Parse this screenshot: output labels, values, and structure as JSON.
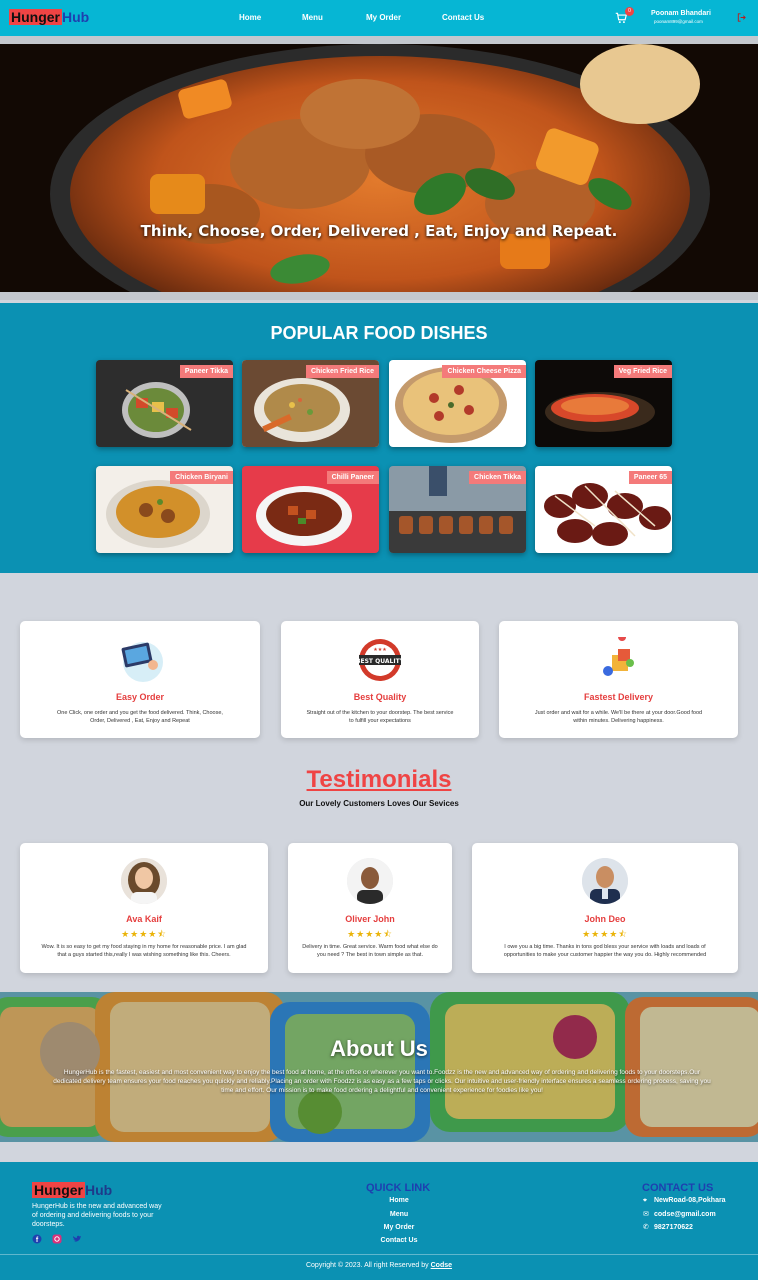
{
  "nav": {
    "logo_a": "Hunger",
    "logo_b": "Hub",
    "links": [
      "Home",
      "Menu",
      "My Order",
      "Contact Us"
    ],
    "cart_count": "0",
    "cart_icon": "cart-icon",
    "user_name": "Poonam Bhandari",
    "user_email": "poonam899@gmail.com",
    "logout_icon": "logout-icon"
  },
  "hero": {
    "tagline": "Think, Choose, Order, Delivered , Eat, Enjoy and Repeat."
  },
  "popular": {
    "title": "POPULAR FOOD DISHES",
    "dishes": [
      "Paneer Tikka",
      "Chicken Fried Rice",
      "Chicken Cheese Pizza",
      "Veg Fried Rice",
      "Chicken Biryani",
      "Chilli Paneer",
      "Chicken Tikka",
      "Paneer 65"
    ]
  },
  "features": [
    {
      "title": "Easy Order",
      "text": "One Click, one order and you get the food delivered. Think, Choose, Order, Delivered , Eat, Enjoy and Repeat",
      "icon": "tablet-order-icon"
    },
    {
      "title": "Best Quality",
      "text": "Straight out of the kitchen to your doorstep. The best service to fulfill your expectations",
      "icon": "best-quality-badge-icon"
    },
    {
      "title": "Fastest Delivery",
      "text": "Just order and wait for a while. We'll be there at your door.Good food within minutes. Delivering happiness.",
      "icon": "delivery-icon"
    }
  ],
  "testimonials": {
    "title": "Testimonials",
    "subtitle": "Our Lovely Customers Loves Our Sevices",
    "items": [
      {
        "name": "Ava Kaif",
        "stars": "★★★★⯪",
        "text": "Wow. It is so easy to get my food staying in my home for reasonable price. I am glad that a guys started this,really I was wishing something like this. Cheers."
      },
      {
        "name": "Oliver John",
        "stars": "★★★★⯪",
        "text": "Delivery in time. Great service. Warm food what else do you need ? The best in town simple as that."
      },
      {
        "name": "John Deo",
        "stars": "★★★★⯪",
        "text": "I owe you a big time. Thanks in tons god bless your service with loads and loads of opportunities to make your customer happier the way you do. Highly recommended"
      }
    ]
  },
  "about": {
    "title": "About Us",
    "text": "HungerHub is the fastest, easiest and most convenient way to enjoy the best food at home, at the office or wherever you want to.Foodzz is the new and advanced way of ordering and delivering foods to your doorsteps.Our dedicated delivery team ensures your food reaches you quickly and reliably.Placing an order with Foodzz is as easy as a few taps or clicks. Our intuitive and user-friendly interface ensures a seamless ordering process, saving you time and effort. Our mission is to make food ordering a delightful and convenient experience for foodies like you!"
  },
  "footer": {
    "logo_a": "Hunger",
    "logo_b": "Hub",
    "description": "HungerHub is the new and advanced way of ordering and delivering foods to your doorsteps.",
    "socials": [
      "facebook-icon",
      "instagram-icon",
      "twitter-icon"
    ],
    "quick_link_title": "QUICK LINK",
    "quick_links": [
      "Home",
      "Menu",
      "My Order",
      "Contact Us"
    ],
    "contact_title": "CONTACT US",
    "address": "NewRoad-08,Pokhara",
    "email": "codse@gmail.com",
    "phone": "9827170622",
    "copyright": "Copyright © 2023. All right Reserved by",
    "brand": "Codse"
  },
  "colors": {
    "nav": "#06b6d4",
    "section": "#0b91b3",
    "accent_red": "#ef4444",
    "logo_blue": "#1e40af",
    "star": "#eab308"
  }
}
